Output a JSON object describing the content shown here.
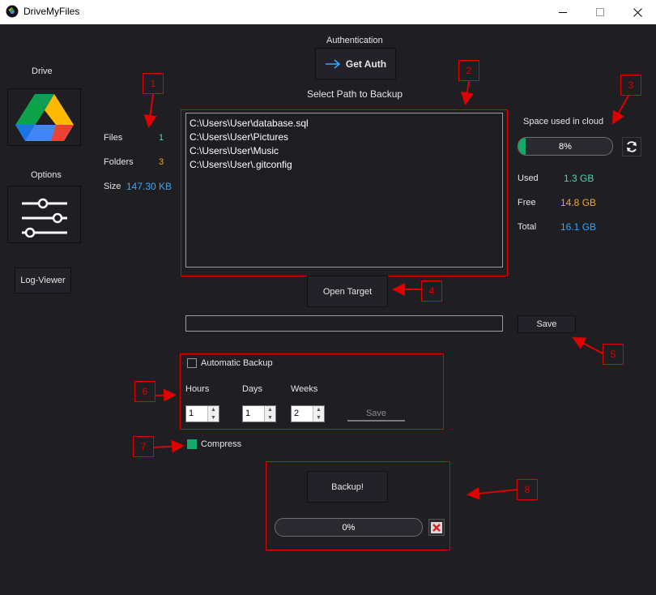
{
  "window": {
    "title": "DriveMyFiles"
  },
  "sidebar": {
    "drive_label": "Drive",
    "options_label": "Options",
    "logviewer_label": "Log-Viewer"
  },
  "auth": {
    "header": "Authentication",
    "button": "Get Auth"
  },
  "paths": {
    "header": "Select Path to Backup",
    "items": [
      "C:\\Users\\User\\database.sql",
      "C:\\Users\\User\\Pictures",
      "C:\\Users\\User\\Music",
      "C:\\Users\\User\\.gitconfig"
    ],
    "open_target_label": "Open Target",
    "target_value": "",
    "save_label": "Save"
  },
  "stats": {
    "files_label": "Files",
    "files_value": "1",
    "folders_label": "Folders",
    "folders_value": "3",
    "size_label": "Size",
    "size_value": "147.30 KB"
  },
  "cloud": {
    "title": "Space used in cloud",
    "percent_text": "8%",
    "percent": 8,
    "used_label": "Used",
    "used_value": "1.3 GB",
    "free_label": "Free",
    "free_value": "14.8 GB",
    "total_label": "Total",
    "total_value": "16.1 GB"
  },
  "auto_backup": {
    "label": "Automatic Backup",
    "checked": false,
    "hours_label": "Hours",
    "days_label": "Days",
    "weeks_label": "Weeks",
    "hours_value": "1",
    "days_value": "1",
    "weeks_value": "2",
    "save_label": "Save"
  },
  "compress": {
    "label": "Compress",
    "checked": true
  },
  "backup": {
    "button": "Backup!",
    "progress_text": "0%",
    "progress": 0
  },
  "annotations": [
    "1",
    "2",
    "3",
    "4",
    "5",
    "6",
    "7",
    "8"
  ],
  "colors": {
    "background": "#1f1e23",
    "green": "#14a86b",
    "teal": "#3ee0a8",
    "orange": "#f5a623",
    "blue": "#2ea8ff",
    "annotation": "#e00000"
  }
}
